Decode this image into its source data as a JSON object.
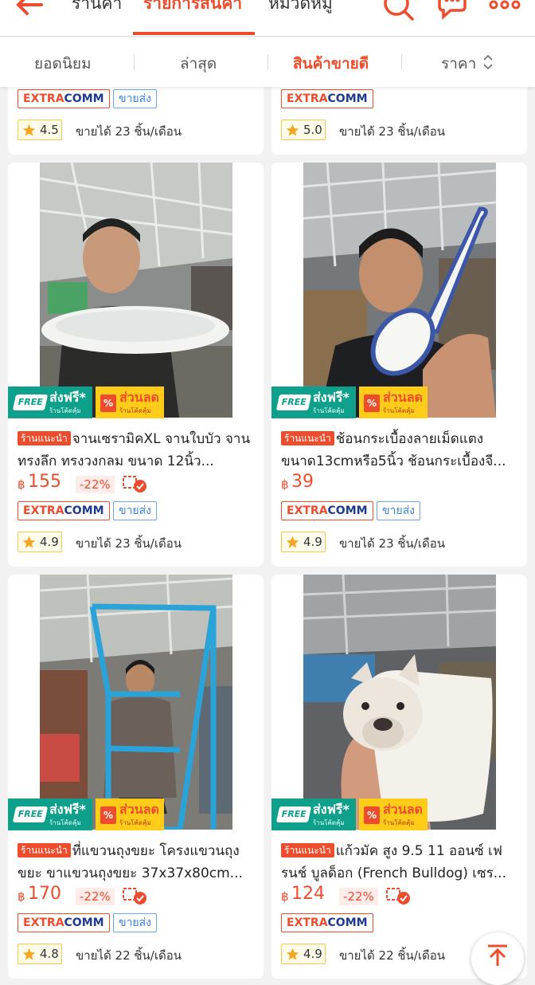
{
  "nav": {
    "tabs": [
      {
        "label": "ร้านค้า"
      },
      {
        "label": "รายการสินค้า"
      },
      {
        "label": "หมวดหมู่"
      }
    ]
  },
  "sort": {
    "options": [
      {
        "label": "ยอดนิยม"
      },
      {
        "label": "ล่าสุด"
      },
      {
        "label": "สินค้าขายดี"
      },
      {
        "label": "ราคา"
      }
    ]
  },
  "colors": {
    "accent": "#ee4d2d",
    "free_shipping": "#0fa08b",
    "discount": "#ffcc1a",
    "wholesale": "#3b82d6"
  },
  "badges": {
    "free_chip": "FREE",
    "free_big": "ส่งฟรี*",
    "free_small": "ร้านโค้ดคุ้ม",
    "discount_pct": "%",
    "discount_big": "ส่วนลด",
    "discount_small": "ร้านโค้ดคุ้ม",
    "recommended": "ร้านแนะนำ",
    "extra": "EXTRA",
    "comm": "COMM",
    "wholesale": "ขายส่ง",
    "currency": "฿"
  },
  "products": [
    {
      "rating": "4.5",
      "sold": "ขายได้ 23 ชิ้น/เดือน"
    },
    {
      "rating": "5.0",
      "sold": "ขายได้ 23 ชิ้น/เดือน"
    },
    {
      "title": "จานเซรามิคXL จานใบบัว จานทรงลึก ทรงวงกลม ขนาด 12นิ้ว...",
      "price": "155",
      "discount": "-22%",
      "rating": "4.9",
      "sold": "ขายได้ 23 ชิ้น/เดือน"
    },
    {
      "title": "ช้อนกระเบื้องลายเม็ดแตง ขนาด13cmหรือ5นิ้ว ช้อนกระเบื้องจี...",
      "price": "39",
      "discount": "",
      "rating": "4.9",
      "sold": "ขายได้ 23 ชิ้น/เดือน"
    },
    {
      "title": "ที่แขวนถุงขยะ โครงแขวนถุงขยะ ขาแขวนถุงขยะ 37x37x80cm...",
      "price": "170",
      "discount": "-22%",
      "rating": "4.8",
      "sold": "ขายได้ 22 ชิ้น/เดือน"
    },
    {
      "title": "แก้วมัค สูง 9.5 11 ออนซ์ เฟรนช์ บูลด็อก (French Bulldog) เซร...",
      "price": "124",
      "discount": "-22%",
      "rating": "4.9",
      "sold": "ขายได้ 22 ชิ้น/เดือน"
    }
  ]
}
